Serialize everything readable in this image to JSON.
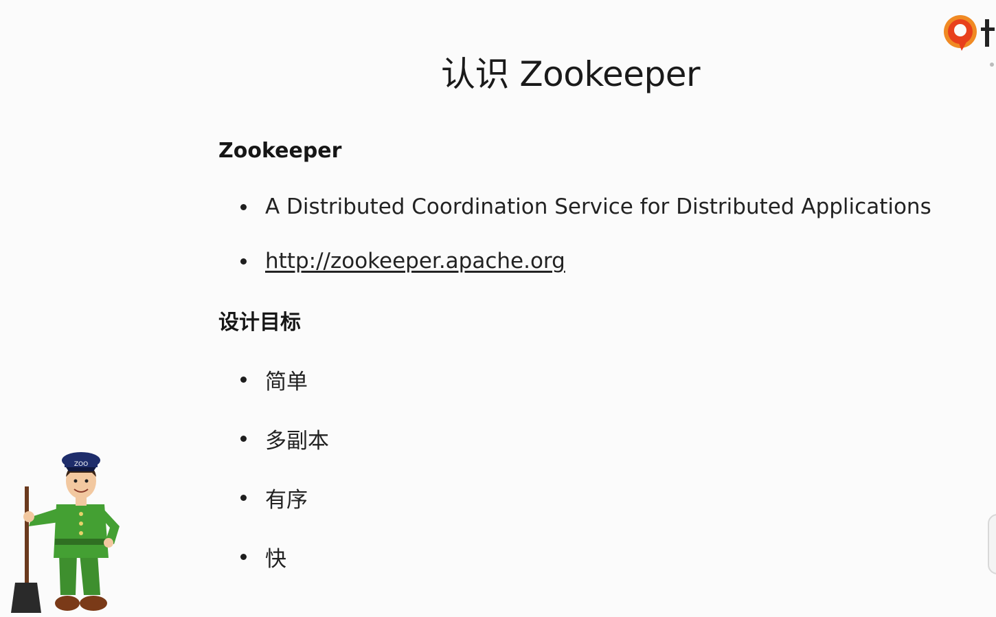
{
  "slide": {
    "title": "认识 Zookeeper"
  },
  "sections": [
    {
      "heading": "Zookeeper",
      "items": [
        "A Distributed Coordination Service for Distributed Applications",
        "http://zookeeper.apache.org"
      ]
    },
    {
      "heading": "设计目标",
      "items": [
        "简单",
        "多副本",
        "有序",
        "快"
      ]
    }
  ],
  "mascot": {
    "hat_text": "ZOO"
  },
  "colors": {
    "background": "#fbfbfb",
    "text": "#1e1e1e",
    "logo_red": "#e8401c",
    "logo_orange": "#f08a24",
    "mascot_green": "#3e8f2e",
    "mascot_hat": "#1e2d6b"
  },
  "icons": {
    "corner_logo": "brand-logo-icon",
    "mascot": "zookeeper-mascot-icon"
  }
}
